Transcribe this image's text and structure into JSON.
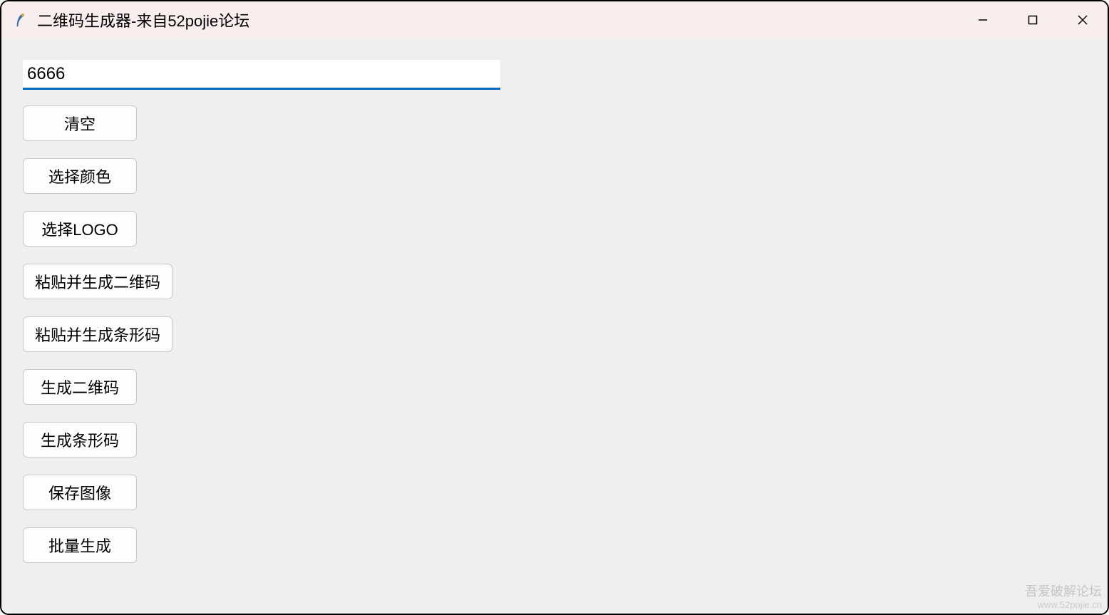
{
  "window": {
    "title": "二维码生成器-来自52pojie论坛"
  },
  "input": {
    "value": "6666"
  },
  "buttons": {
    "clear": "清空",
    "choose_color": "选择颜色",
    "choose_logo": "选择LOGO",
    "paste_gen_qr": "粘贴并生成二维码",
    "paste_gen_barcode": "粘贴并生成条形码",
    "gen_qr": "生成二维码",
    "gen_barcode": "生成条形码",
    "save_image": "保存图像",
    "batch_gen": "批量生成"
  },
  "watermark": {
    "line1": "吾爱破解论坛",
    "line2": "www.52pojie.cn"
  }
}
